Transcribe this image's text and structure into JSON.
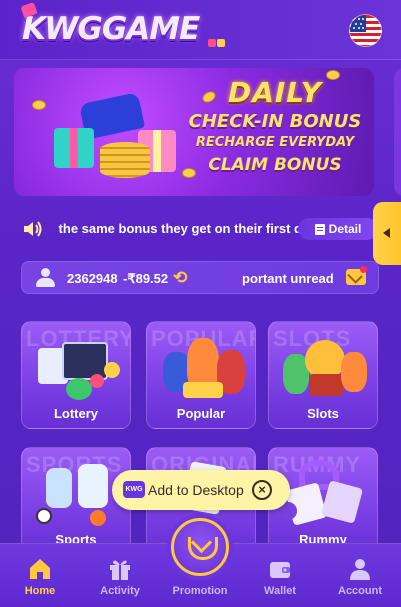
{
  "header": {
    "logo_text": "KWGGAME",
    "language_flag": "us-flag-icon"
  },
  "banner": {
    "line1": "DAILY",
    "line2": "CHECK-IN BONUS",
    "line3": "RECHARGE EVERYDAY",
    "line4": "CLAIM BONUS"
  },
  "notice": {
    "text": "n the same bonus they get on their first d",
    "detail_label": "Detail"
  },
  "user": {
    "id": "2362948",
    "balance": "-₹89.52",
    "unread_text": "portant unread"
  },
  "games": [
    {
      "label": "Lottery",
      "ghost": "LOTTERY"
    },
    {
      "label": "Popular",
      "ghost": "POPULAR"
    },
    {
      "label": "Slots",
      "ghost": "SLOTS"
    },
    {
      "label": "Sports",
      "ghost": "SPORTS"
    },
    {
      "label": "",
      "ghost": "ORIGINAL"
    },
    {
      "label": "Rummy",
      "ghost": "RUMMY"
    }
  ],
  "add_to_desktop": {
    "badge": "KWG",
    "label": "Add to Desktop"
  },
  "nav": [
    {
      "label": "Home",
      "icon": "home-icon"
    },
    {
      "label": "Activity",
      "icon": "gift-icon"
    },
    {
      "label": "Promotion",
      "icon": "diamond-icon"
    },
    {
      "label": "Wallet",
      "icon": "wallet-icon"
    },
    {
      "label": "Account",
      "icon": "account-icon"
    }
  ],
  "colors": {
    "accent": "#ffc83d",
    "background": "#5a25c8",
    "card": "#7b3fe4"
  }
}
